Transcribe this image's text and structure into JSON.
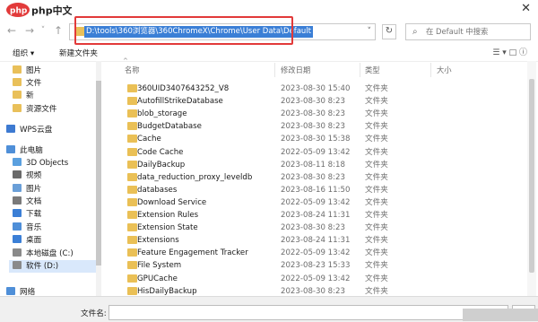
{
  "watermark": {
    "text": "php中文网"
  },
  "nav": {
    "back": "←",
    "forward": "→",
    "up": "↑",
    "address_path": "D:\\tools\\360浏览器\\360ChromeX\\Chrome\\User Data\\Default",
    "search_placeholder": "在 Default 中搜索"
  },
  "toolbar": {
    "organize": "组织 ▾",
    "new_folder": "新建文件夹"
  },
  "sidebar": {
    "items": [
      {
        "label": "图片",
        "icon": "folder-icon",
        "color": "#e9c05a"
      },
      {
        "label": "文件",
        "icon": "folder-icon",
        "color": "#e9c05a"
      },
      {
        "label": "新",
        "icon": "folder-icon",
        "color": "#e9c05a"
      },
      {
        "label": "资源文件",
        "icon": "folder-icon",
        "color": "#e9c05a"
      },
      {
        "label": "WPS云盘",
        "icon": "cloud-icon",
        "color": "#3d7ad1"
      },
      {
        "label": "此电脑",
        "icon": "computer-icon",
        "color": "#4f8fd8"
      },
      {
        "label": "3D Objects",
        "icon": "cube-icon",
        "color": "#5aa0df"
      },
      {
        "label": "视频",
        "icon": "video-icon",
        "color": "#6a6a6a"
      },
      {
        "label": "图片",
        "icon": "picture-icon",
        "color": "#6a9fd8"
      },
      {
        "label": "文档",
        "icon": "document-icon",
        "color": "#7a7a7a"
      },
      {
        "label": "下载",
        "icon": "download-icon",
        "color": "#3b7fd6"
      },
      {
        "label": "音乐",
        "icon": "music-icon",
        "color": "#4f8fd8"
      },
      {
        "label": "桌面",
        "icon": "desktop-icon",
        "color": "#3b7fd6"
      },
      {
        "label": "本地磁盘 (C:)",
        "icon": "drive-icon",
        "color": "#8a8a8a"
      },
      {
        "label": "软件 (D:)",
        "icon": "drive-icon",
        "color": "#8a8a8a"
      },
      {
        "label": "网络",
        "icon": "network-icon",
        "color": "#4f8fd8"
      }
    ]
  },
  "columns": {
    "name": "名称",
    "modified": "修改日期",
    "type": "类型",
    "size": "大小"
  },
  "files": [
    {
      "name": "360UID3407643252_V8",
      "modified": "2023-08-30 15:40",
      "type": "文件夹"
    },
    {
      "name": "AutofillStrikeDatabase",
      "modified": "2023-08-30 8:23",
      "type": "文件夹"
    },
    {
      "name": "blob_storage",
      "modified": "2023-08-30 8:23",
      "type": "文件夹"
    },
    {
      "name": "BudgetDatabase",
      "modified": "2023-08-30 8:23",
      "type": "文件夹"
    },
    {
      "name": "Cache",
      "modified": "2023-08-30 15:38",
      "type": "文件夹"
    },
    {
      "name": "Code Cache",
      "modified": "2022-05-09 13:42",
      "type": "文件夹"
    },
    {
      "name": "DailyBackup",
      "modified": "2023-08-11 8:18",
      "type": "文件夹"
    },
    {
      "name": "data_reduction_proxy_leveldb",
      "modified": "2023-08-30 8:23",
      "type": "文件夹"
    },
    {
      "name": "databases",
      "modified": "2023-08-16 11:50",
      "type": "文件夹"
    },
    {
      "name": "Download Service",
      "modified": "2022-05-09 13:42",
      "type": "文件夹"
    },
    {
      "name": "Extension Rules",
      "modified": "2023-08-24 11:31",
      "type": "文件夹"
    },
    {
      "name": "Extension State",
      "modified": "2023-08-30 8:23",
      "type": "文件夹"
    },
    {
      "name": "Extensions",
      "modified": "2023-08-24 11:31",
      "type": "文件夹"
    },
    {
      "name": "Feature Engagement Tracker",
      "modified": "2022-05-09 13:42",
      "type": "文件夹"
    },
    {
      "name": "File System",
      "modified": "2023-08-23 15:33",
      "type": "文件夹"
    },
    {
      "name": "GPUCache",
      "modified": "2022-05-09 13:42",
      "type": "文件夹"
    },
    {
      "name": "HisDailyBackup",
      "modified": "2023-08-30 8:23",
      "type": "文件夹"
    }
  ],
  "bottom": {
    "filename_label": "文件名:"
  },
  "colors": {
    "selection": "#3b7fd6",
    "highlight_box": "#e23a3a",
    "folder": "#eac056"
  }
}
